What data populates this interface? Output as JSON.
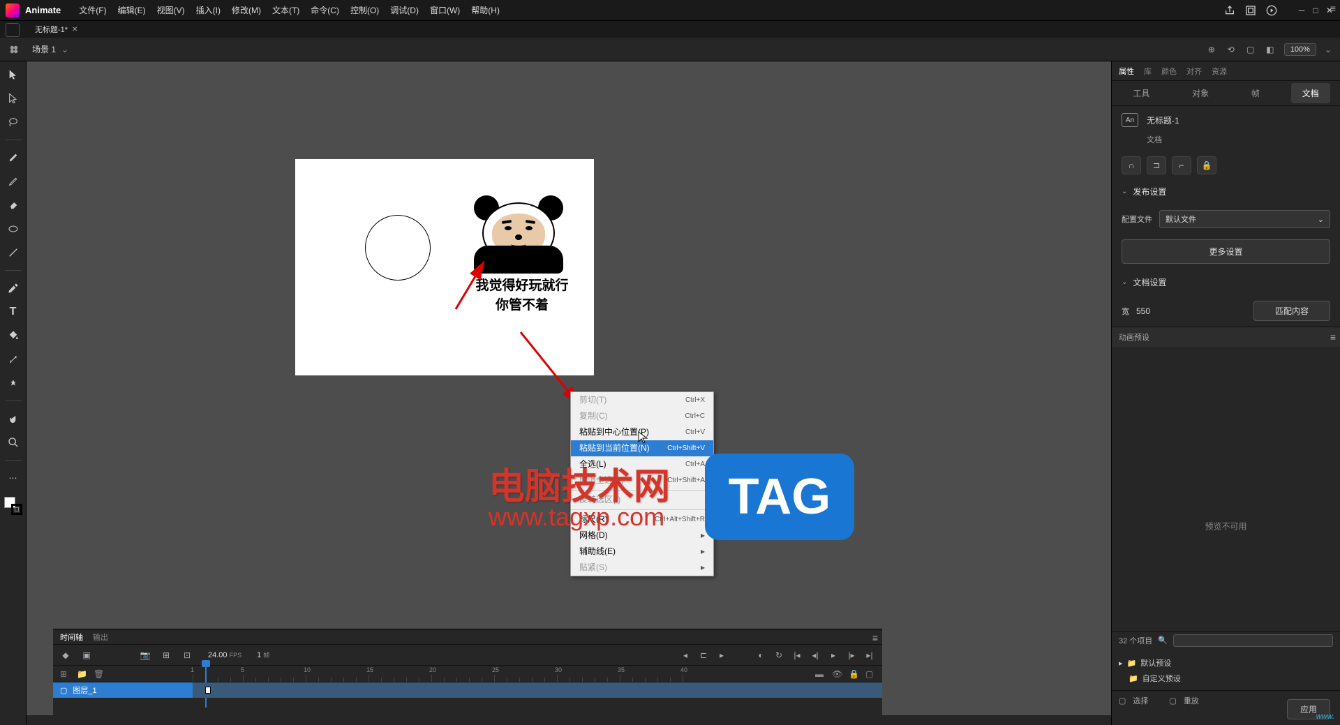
{
  "app": {
    "brand": "Animate"
  },
  "menu": [
    "文件(F)",
    "编辑(E)",
    "视图(V)",
    "插入(I)",
    "修改(M)",
    "文本(T)",
    "命令(C)",
    "控制(O)",
    "调试(D)",
    "窗口(W)",
    "帮助(H)"
  ],
  "tab": {
    "name": "无标题-1*"
  },
  "scene": {
    "label": "场景 1",
    "zoom": "100%"
  },
  "stage": {
    "caption_line1": "我觉得好玩就行",
    "caption_line2": "你管不着"
  },
  "context_menu": [
    {
      "label": "剪切(T)",
      "shortcut": "Ctrl+X",
      "disabled": true
    },
    {
      "label": "复制(C)",
      "shortcut": "Ctrl+C",
      "disabled": true
    },
    {
      "label": "粘贴到中心位置(P)",
      "shortcut": "Ctrl+V"
    },
    {
      "label": "粘贴到当前位置(N)",
      "shortcut": "Ctrl+Shift+V",
      "highlight": true
    },
    {
      "label": "全选(L)",
      "shortcut": "Ctrl+A"
    },
    {
      "label": "取消全选(V)",
      "shortcut": "Ctrl+Shift+A",
      "disabled": true
    },
    {
      "sep": true
    },
    {
      "label": "反转选区(I)",
      "disabled": true
    },
    {
      "sep": true
    },
    {
      "label": "标尺(R)",
      "shortcut": "Ctrl+Alt+Shift+R"
    },
    {
      "label": "网格(D)",
      "submenu": true
    },
    {
      "label": "辅助线(E)",
      "submenu": true
    },
    {
      "label": "贴紧(S)",
      "submenu": true,
      "disabled": true
    }
  ],
  "right_panel": {
    "tabs": [
      "属性",
      "库",
      "颜色",
      "对齐",
      "资源"
    ],
    "subtabs": [
      "工具",
      "对象",
      "帧",
      "文档"
    ],
    "active_subtab": "文档",
    "doc_name": "无标题-1",
    "doc_type": "文档",
    "an_badge": "An",
    "publish_section": "发布设置",
    "config_label": "配置文件",
    "config_value": "默认文件",
    "more_settings": "更多设置",
    "doc_section": "文档设置",
    "width_label": "宽",
    "width_value": "550",
    "match_content": "匹配内容",
    "preset_title": "动画预设",
    "preset_empty": "预览不可用",
    "preset_count": "32 个项目",
    "preset_folders": [
      "默认预设",
      "自定义预设"
    ],
    "apply": "应用",
    "option_label": "选择",
    "replay_label": "重放"
  },
  "timeline": {
    "tabs": [
      "时间轴",
      "输出"
    ],
    "fps": "24.00",
    "fps_unit": "FPS",
    "frame": "1",
    "frame_unit": "帧",
    "layer": "图层_1",
    "ruler_marks": [
      "1",
      "5",
      "10",
      "15",
      "20",
      "25",
      "30",
      "35"
    ]
  },
  "watermark": {
    "text1": "电脑技术网",
    "text2": "www.tagxp.com",
    "tag": "TAG"
  },
  "corner": "www."
}
